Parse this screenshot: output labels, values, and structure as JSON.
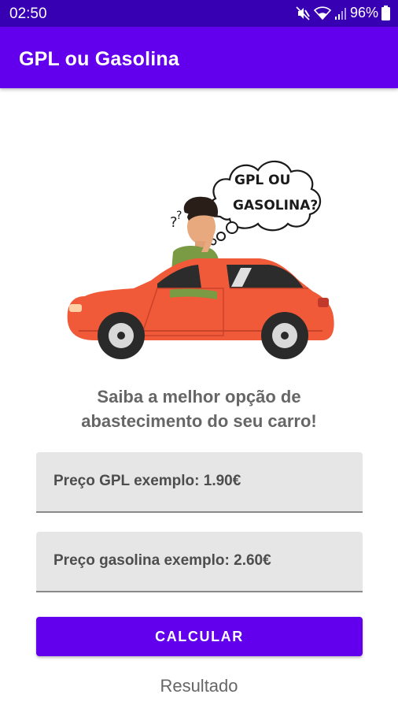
{
  "status_bar": {
    "time": "02:50",
    "battery_percent": "96%",
    "icons": [
      "mute-icon",
      "wifi-icon",
      "signal-icon",
      "battery-icon"
    ]
  },
  "app_bar": {
    "title": "GPL ou Gasolina",
    "color": "#6200ee"
  },
  "illustration": {
    "thought_line1": "GPL OU",
    "thought_line2": "GASOLINA?",
    "question_marks": "?",
    "car_color": "#f05a38"
  },
  "tagline": {
    "line1": "Saiba a melhor opção de",
    "line2": "abastecimento do seu carro!"
  },
  "form": {
    "gpl_placeholder": "Preço GPL exemplo: 1.90€",
    "gasoline_placeholder": "Preço gasolina exemplo: 2.60€",
    "calculate_label": "CALCULAR"
  },
  "result": {
    "text": "Resultado"
  }
}
